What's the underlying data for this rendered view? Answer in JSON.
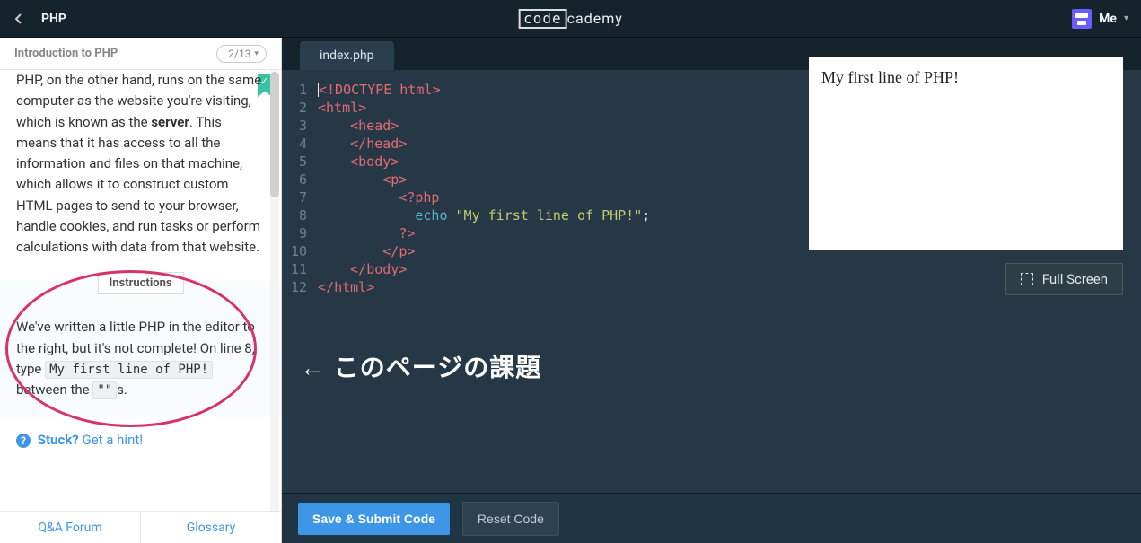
{
  "topbar": {
    "course": "PHP",
    "logo_left": "code",
    "logo_right": "cademy",
    "me_label": "Me"
  },
  "sidebar": {
    "lesson_title": "Introduction to PHP",
    "progress": "2/13",
    "body_text_pre": "PHP, on the other hand, runs on the same computer as the website you're visiting, which is known as the ",
    "body_text_strong": "server",
    "body_text_post": ". This means that it has access to all the information and files on that machine, which allows it to construct custom HTML pages to send to your browser, handle cookies, and run tasks or perform calculations with data from that website.",
    "instructions_label": "Instructions",
    "instructions_1": "We've written a little PHP in the editor to the right, but it's not complete! On line 8, type ",
    "instructions_code": "My first line of PHP!",
    "instructions_2": " between the ",
    "instructions_code2": "\"\"",
    "instructions_3": "s.",
    "stuck_label": "Stuck?",
    "hint_link": "Get a hint!",
    "footer_qa": "Q&A Forum",
    "footer_glossary": "Glossary"
  },
  "editor": {
    "tab": "index.php",
    "lines": [
      {
        "n": 1,
        "html": "<span class='delim'>&lt;</span><span class='tag'>!DOCTYPE html</span><span class='delim'>&gt;</span>"
      },
      {
        "n": 2,
        "html": "<span class='delim'>&lt;</span><span class='tag'>html</span><span class='delim'>&gt;</span>"
      },
      {
        "n": 3,
        "html": "    <span class='delim'>&lt;</span><span class='tag'>head</span><span class='delim'>&gt;</span>"
      },
      {
        "n": 4,
        "html": "    <span class='delim'>&lt;/</span><span class='tag'>head</span><span class='delim'>&gt;</span>"
      },
      {
        "n": 5,
        "html": "    <span class='delim'>&lt;</span><span class='tag'>body</span><span class='delim'>&gt;</span>"
      },
      {
        "n": 6,
        "html": "        <span class='delim'>&lt;</span><span class='tag'>p</span><span class='delim'>&gt;</span>"
      },
      {
        "n": 7,
        "html": "          <span class='delim'>&lt;?</span><span class='tag'>php</span>"
      },
      {
        "n": 8,
        "html": "            <span class='kw'>echo</span> <span class='str'>\"My first line of PHP!\"</span><span class='punc'>;</span>"
      },
      {
        "n": 9,
        "html": "          <span class='delim'>?&gt;</span>"
      },
      {
        "n": 10,
        "html": "        <span class='delim'>&lt;/</span><span class='tag'>p</span><span class='delim'>&gt;</span>"
      },
      {
        "n": 11,
        "html": "    <span class='delim'>&lt;/</span><span class='tag'>body</span><span class='delim'>&gt;</span>"
      },
      {
        "n": 12,
        "html": "<span class='delim'>&lt;/</span><span class='tag'>html</span><span class='delim'>&gt;</span>"
      }
    ],
    "overlay": "←  このページの課題"
  },
  "output": {
    "text": "My first line of PHP!",
    "fullscreen_label": "Full Screen"
  },
  "bottom": {
    "save": "Save & Submit Code",
    "reset": "Reset Code"
  }
}
